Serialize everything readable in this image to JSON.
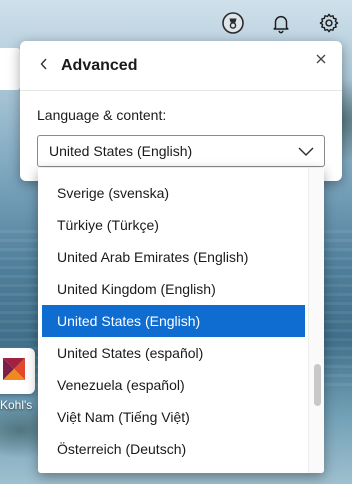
{
  "colors": {
    "accent": "#0f6cd0",
    "panel_bg": "#ffffff",
    "text": "#1a1a1a"
  },
  "topbar": {
    "icons": [
      "rewards-icon",
      "notification-bell-icon",
      "gear-icon"
    ]
  },
  "background_tile": {
    "label": "Kohl's",
    "icon": "kohls-logo-icon"
  },
  "panel": {
    "back_icon": "chevron-left-icon",
    "title": "Advanced",
    "close_icon": "close-icon",
    "language_label": "Language & content:",
    "language_select": {
      "value": "United States (English)",
      "chevron_icon": "chevron-down-icon"
    }
  },
  "dropdown": {
    "options": [
      {
        "label": "Sverige (svenska)",
        "selected": false
      },
      {
        "label": "Türkiye (Türkçe)",
        "selected": false
      },
      {
        "label": "United Arab Emirates (English)",
        "selected": false
      },
      {
        "label": "United Kingdom (English)",
        "selected": false
      },
      {
        "label": "United States (English)",
        "selected": true
      },
      {
        "label": "United States (español)",
        "selected": false
      },
      {
        "label": "Venezuela (español)",
        "selected": false
      },
      {
        "label": "Việt Nam (Tiếng Việt)",
        "selected": false
      },
      {
        "label": "Österreich (Deutsch)",
        "selected": false
      }
    ]
  }
}
